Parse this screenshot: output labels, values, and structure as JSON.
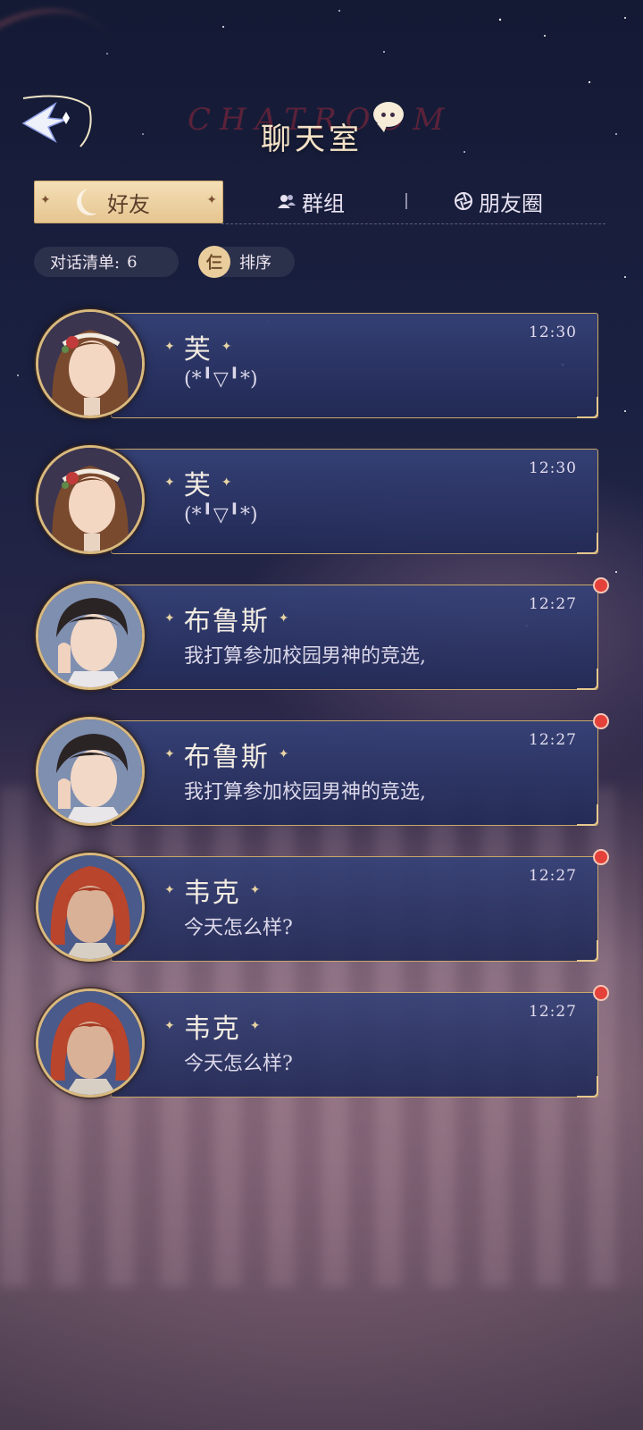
{
  "header": {
    "title": "聊天室",
    "title_decor": "CHATROOM",
    "back_icon": "back-arrow-icon"
  },
  "tabs": {
    "friends": "好友",
    "groups": "群组",
    "moments": "朋友圈",
    "active": "friends"
  },
  "toolbar": {
    "count_label": "对话清单:",
    "count_value": "6",
    "sort_badge": "仨",
    "sort_label": "排序"
  },
  "chats": [
    {
      "name": "芙",
      "message": "(*╹▽╹*)",
      "time": "12:30",
      "unread": false,
      "avatar": "female-brown-hair-rose"
    },
    {
      "name": "芙",
      "message": "(*╹▽╹*)",
      "time": "12:30",
      "unread": false,
      "avatar": "female-brown-hair-rose"
    },
    {
      "name": "布鲁斯",
      "message": "我打算参加校园男神的竞选,",
      "time": "12:27",
      "unread": true,
      "avatar": "male-dark-hair-wink"
    },
    {
      "name": "布鲁斯",
      "message": "我打算参加校园男神的竞选,",
      "time": "12:27",
      "unread": true,
      "avatar": "male-dark-hair-wink"
    },
    {
      "name": "韦克",
      "message": "今天怎么样?",
      "time": "12:27",
      "unread": true,
      "avatar": "male-red-hair"
    },
    {
      "name": "韦克",
      "message": "今天怎么样?",
      "time": "12:27",
      "unread": true,
      "avatar": "male-red-hair"
    }
  ],
  "colors": {
    "accent_gold": "#d9b97d",
    "unread_red": "#e4413a",
    "card_blue": "#36427a"
  }
}
